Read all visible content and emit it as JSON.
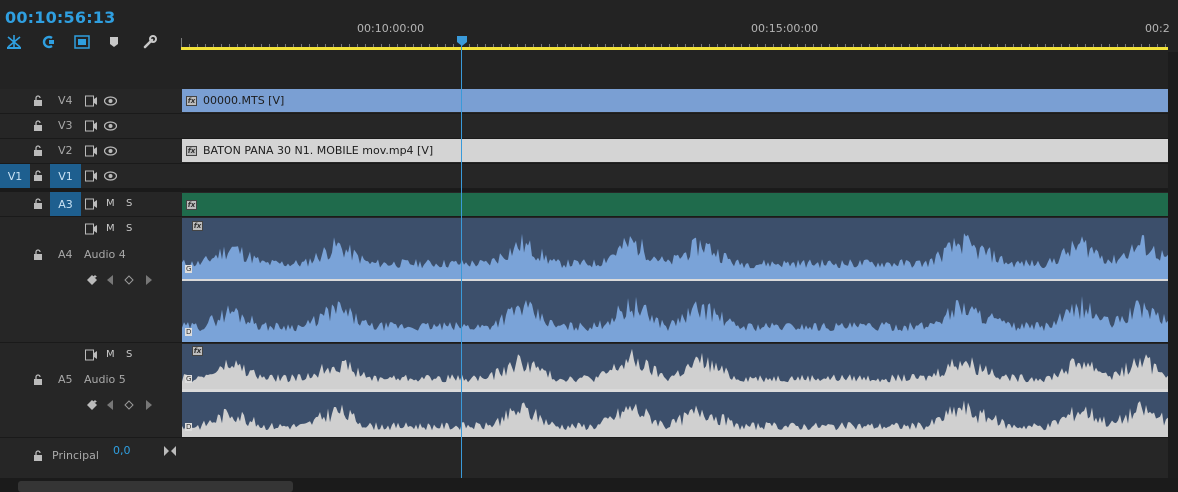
{
  "timeline": {
    "timecode": "00:10:56:13",
    "ruler_labels": [
      "00:10:00:00",
      "00:15:00:00",
      "00:2"
    ],
    "playhead_color": "#3a9ad9",
    "workarea_color": "#f2e23a"
  },
  "tools": [
    {
      "name": "snap-in-sequence-icon"
    },
    {
      "name": "linked-selection-icon"
    },
    {
      "name": "insert-sequence-icon"
    },
    {
      "name": "add-marker-icon"
    },
    {
      "name": "timeline-settings-wrench-icon"
    }
  ],
  "video_tracks": [
    {
      "label": "V4",
      "clip": "00000.MTS [V]",
      "clip_color": "#7a9fd3"
    },
    {
      "label": "V3",
      "clip": "",
      "clip_color": ""
    },
    {
      "label": "V2",
      "clip": "BATON PANA 30 N1. MOBILE mov.mp4 [V]",
      "clip_color": "#d4d4d4"
    },
    {
      "label": "V1",
      "source": "V1",
      "clip": "",
      "clip_color": ""
    }
  ],
  "audio_tracks": [
    {
      "label": "A3",
      "name": "",
      "m": "M",
      "s": "S",
      "clip_color": "#1f6b4c"
    },
    {
      "label": "A4",
      "name": "Audio 4",
      "m": "M",
      "s": "S",
      "clip_color": "#7aa3d8",
      "channels": [
        "G",
        "D"
      ]
    },
    {
      "label": "A5",
      "name": "Audio 5",
      "m": "M",
      "s": "S",
      "clip_color": "#d0d0d0",
      "channels": [
        "G",
        "D"
      ]
    }
  ],
  "master": {
    "name": "Principal",
    "value": "0,0"
  }
}
